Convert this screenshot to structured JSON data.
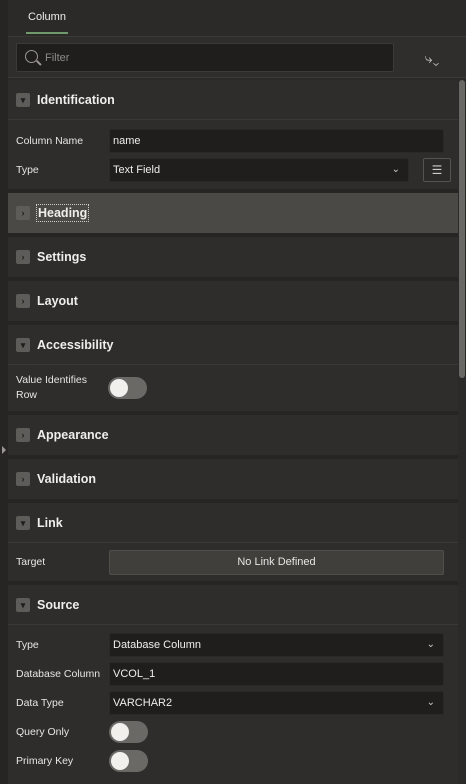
{
  "tab": {
    "label": "Column"
  },
  "filter": {
    "placeholder": "Filter",
    "goto_icon": "goto-group-icon"
  },
  "identification": {
    "title": "Identification",
    "column_name_label": "Column Name",
    "column_name_value": "name",
    "type_label": "Type",
    "type_value": "Text Field"
  },
  "heading": {
    "title": "Heading"
  },
  "settings": {
    "title": "Settings"
  },
  "layout": {
    "title": "Layout"
  },
  "accessibility": {
    "title": "Accessibility",
    "value_identifies_row_label": "Value Identifies Row",
    "value_identifies_row_on": false
  },
  "appearance": {
    "title": "Appearance"
  },
  "validation": {
    "title": "Validation"
  },
  "link": {
    "title": "Link",
    "target_label": "Target",
    "target_value": "No Link Defined"
  },
  "source": {
    "title": "Source",
    "type_label": "Type",
    "type_value": "Database Column",
    "db_column_label": "Database Column",
    "db_column_value": "VCOL_1",
    "data_type_label": "Data Type",
    "data_type_value": "VARCHAR2",
    "query_only_label": "Query Only",
    "query_only_on": false,
    "primary_key_label": "Primary Key",
    "primary_key_on": false
  },
  "colors": {
    "accent": "#6f9a6b",
    "background": "#2b2a28",
    "field": "#1f1e1d"
  }
}
